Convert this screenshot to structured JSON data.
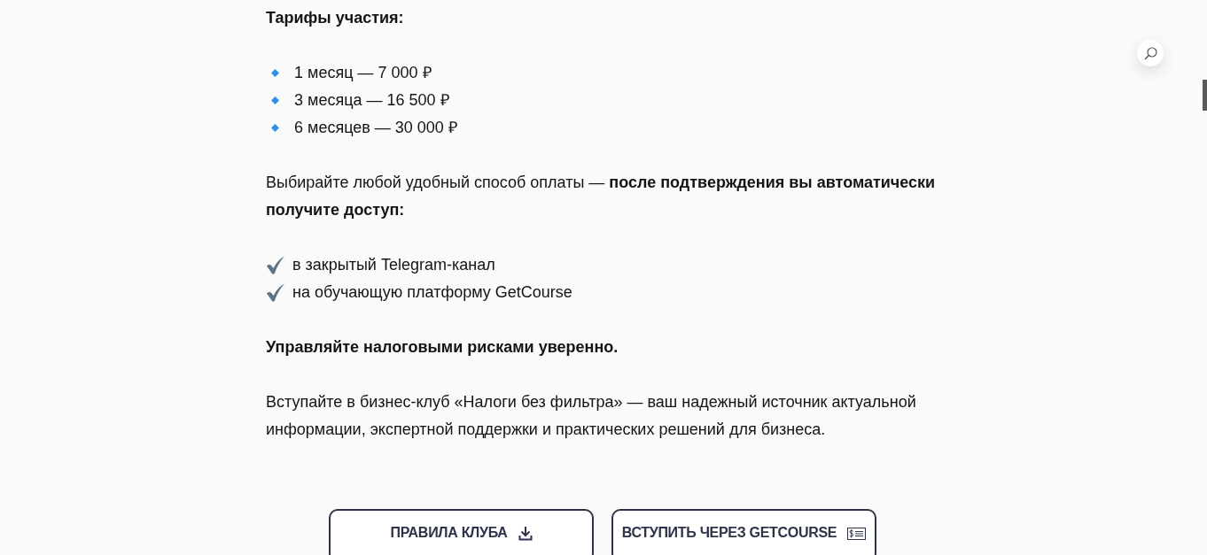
{
  "heading": "Тарифы участия:",
  "tariffs": [
    "1 месяц — 7 000 ₽",
    "3 месяца — 16 500 ₽",
    "6 месяцев — 30 000 ₽"
  ],
  "payment_note": "Выбирайте любой удобный способ оплаты — **после подтверждения вы автоматически получите доступ:**",
  "access_items": [
    "в закрытый Telegram-канал",
    "на обучающую платформу GetCourse"
  ],
  "call_to_action": "Управляйте налоговыми рисками уверенно.",
  "description": "Вступайте в бизнес-клуб «Налоги без фильтра» — ваш надежный источник актуальной информации, экспертной поддержки и практических решений для бизнеса.",
  "buttons": [
    {
      "label": "ПРАВИЛА КЛУБА",
      "kind": "download"
    },
    {
      "label": "ВСТУПИТЬ ЧЕРЕЗ GETCOURSE",
      "kind": "bill"
    }
  ]
}
